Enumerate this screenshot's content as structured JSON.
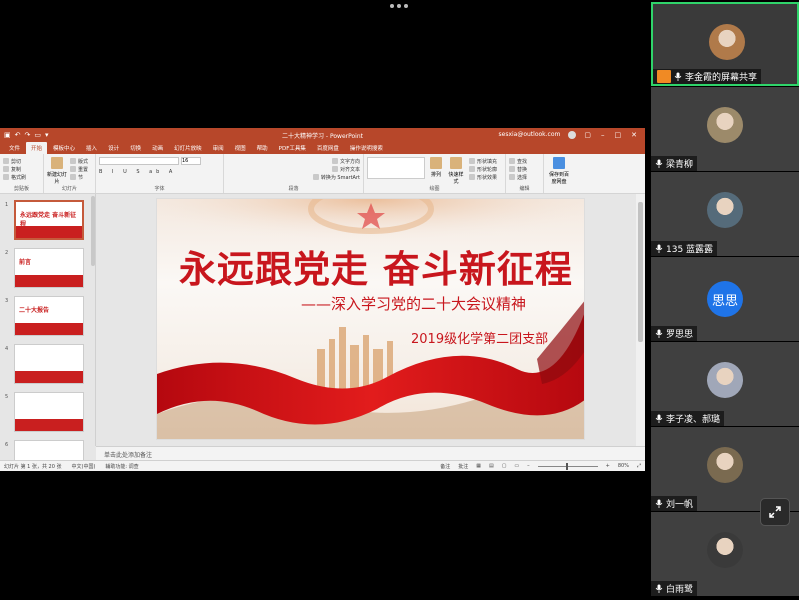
{
  "ppt": {
    "doc_title": "二十大精神学习 - PowerPoint",
    "account": "sesxia@outlook.com",
    "tabs": [
      "文件",
      "开始",
      "模板中心",
      "插入",
      "设计",
      "切换",
      "动画",
      "幻灯片放映",
      "审阅",
      "视图",
      "帮助",
      "PDF工具集",
      "百度网盘",
      "操作说明搜索"
    ],
    "active_tab": "开始",
    "groups": {
      "clipboard": "剪贴板",
      "cut": "剪切",
      "copy": "复制",
      "format_painter": "格式刷",
      "slides": "幻灯片",
      "new_slide": "新建幻灯片",
      "layout": "版式",
      "reset": "重置",
      "section": "节",
      "font": "字体",
      "font_size": "16",
      "paragraph": "段落",
      "text_direction": "文字方向",
      "align_text": "对齐文本",
      "smartart": "转换为 SmartArt",
      "drawing": "绘图",
      "arrange": "排列",
      "quick_styles": "快速样式",
      "shape_fill": "形状填充",
      "shape_outline": "形状轮廓",
      "shape_effects": "形状效果",
      "editing": "编辑",
      "find": "查找",
      "replace": "替换",
      "select": "选择",
      "save_baidu": "保存到百度网盘"
    },
    "thumbnails": [
      {
        "num": "1",
        "label": "永远跟党走 奋斗新征程"
      },
      {
        "num": "2",
        "label": "前言"
      },
      {
        "num": "3",
        "label": "二十大报告"
      },
      {
        "num": "4",
        "label": ""
      },
      {
        "num": "5",
        "label": ""
      },
      {
        "num": "6",
        "label": ""
      }
    ],
    "slide": {
      "title": "永远跟党走 奋斗新征程",
      "subtitle": "——深入学习党的二十大会议精神",
      "org": "2019级化学第二团支部"
    },
    "notes_placeholder": "单击此处添加备注",
    "status": {
      "slide_info": "幻灯片 第 1 张，共 20 张",
      "lang": "中文(中国)",
      "accessibility": "辅助功能: 调查",
      "notes": "备注",
      "comments": "批注",
      "zoom": "80%"
    }
  },
  "participants": [
    {
      "name": "李金霞的屏幕共享",
      "kind": "share"
    },
    {
      "name": "梁青柳",
      "kind": "photo"
    },
    {
      "name": "135 蓝露露",
      "kind": "photo"
    },
    {
      "name": "罗思思",
      "kind": "letter",
      "avatar_text": "思思"
    },
    {
      "name": "李子凌、郝璐",
      "kind": "photo"
    },
    {
      "name": "刘一帆",
      "kind": "photo"
    },
    {
      "name": "白雨鹭",
      "kind": "photo"
    }
  ],
  "colors": {
    "ppt_accent": "#b7472a",
    "slide_red": "#c8161d",
    "active_border": "#2fd46a",
    "letter_avatar": "#1f74e8"
  }
}
